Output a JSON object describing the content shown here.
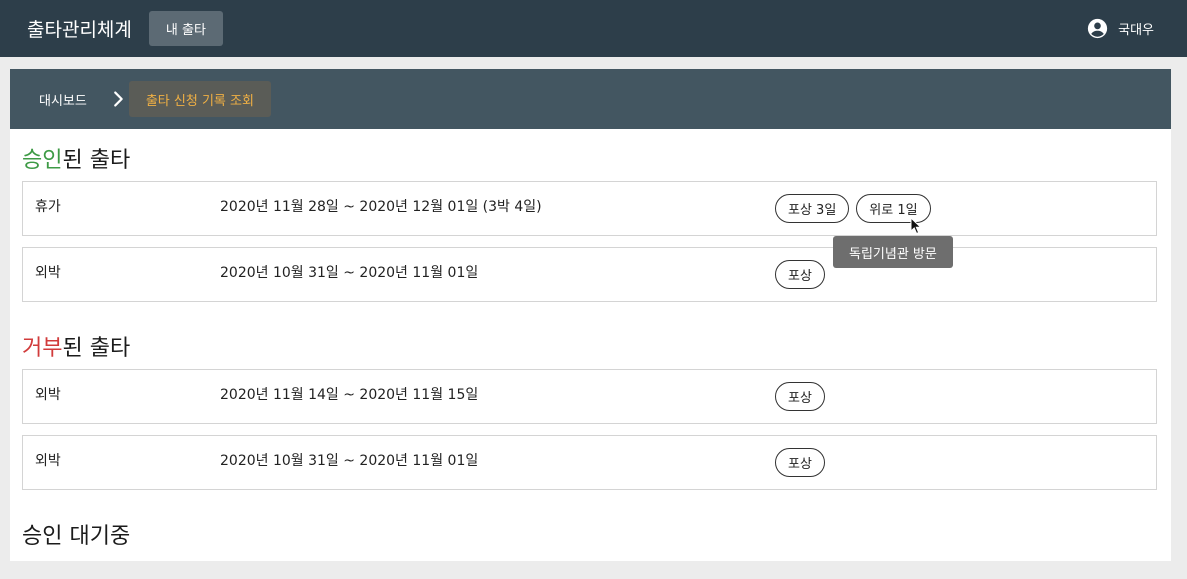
{
  "header": {
    "title": "출타관리체계",
    "nav_button": "내 출타",
    "user_icon": "account-circle-icon",
    "user_name": "국대우"
  },
  "breadcrumb": {
    "home": "대시보드",
    "separator_icon": "chevron-right-icon",
    "current": "출타 신청 기록 조회"
  },
  "sections": {
    "approved": {
      "title_colored": "승인",
      "title_rest": "된 출타",
      "color": "#3d9a45",
      "rows": [
        {
          "type": "휴가",
          "dates": "2020년 11월 28일 ~ 2020년 12월 01일 (3박 4일)",
          "tags": [
            "포상 3일",
            "위로 1일"
          ]
        },
        {
          "type": "외박",
          "dates": "2020년 10월 31일 ~ 2020년 11월 01일",
          "tags": [
            "포상"
          ]
        }
      ]
    },
    "rejected": {
      "title_colored": "거부",
      "title_rest": "된 출타",
      "color": "#d13b3b",
      "rows": [
        {
          "type": "외박",
          "dates": "2020년 11월 14일 ~ 2020년 11월 15일",
          "tags": [
            "포상"
          ]
        },
        {
          "type": "외박",
          "dates": "2020년 10월 31일 ~ 2020년 11월 01일",
          "tags": [
            "포상"
          ]
        }
      ]
    },
    "pending": {
      "title": "승인 대기중"
    }
  },
  "tooltip": {
    "text": "독립기념관 방문"
  }
}
